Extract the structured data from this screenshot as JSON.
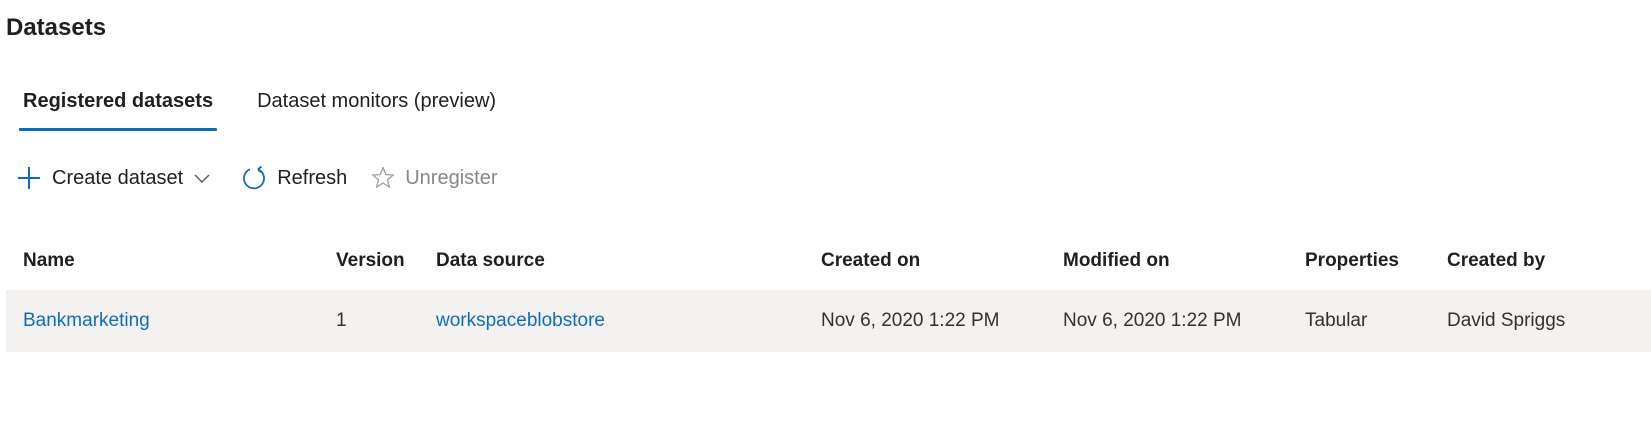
{
  "page": {
    "title": "Datasets"
  },
  "tabs": [
    {
      "label": "Registered datasets",
      "active": true
    },
    {
      "label": "Dataset monitors (preview)",
      "active": false
    }
  ],
  "toolbar": {
    "create_label": "Create dataset",
    "refresh_label": "Refresh",
    "unregister_label": "Unregister"
  },
  "table": {
    "headers": {
      "name": "Name",
      "version": "Version",
      "source": "Data source",
      "created": "Created on",
      "modified": "Modified on",
      "properties": "Properties",
      "created_by": "Created by"
    },
    "rows": [
      {
        "name": "Bankmarketing",
        "version": "1",
        "source": "workspaceblobstore",
        "created": "Nov 6, 2020 1:22 PM",
        "modified": "Nov 6, 2020 1:22 PM",
        "properties": "Tabular",
        "created_by": "David Spriggs"
      }
    ]
  },
  "colors": {
    "accent": "#0f6cbd",
    "text": "#201f1e",
    "disabled": "#8a8886",
    "row_bg": "#f3f2f1"
  },
  "icons": {
    "create": "plus-icon",
    "create_menu": "chevron-down-icon",
    "refresh": "refresh-icon",
    "unregister": "star-icon"
  }
}
